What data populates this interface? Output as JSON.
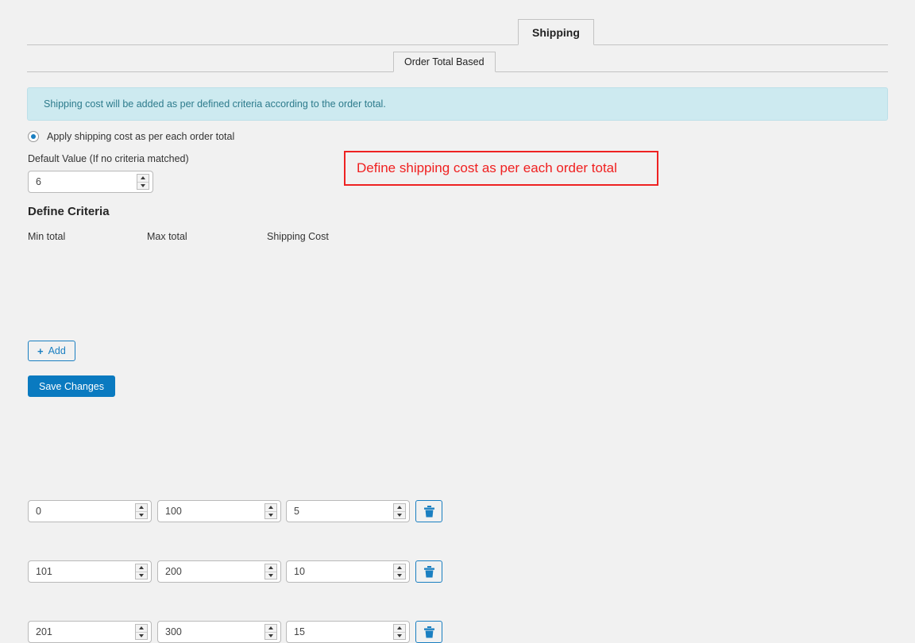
{
  "tabs": {
    "primary": [
      {
        "label": "Shipping",
        "active": true
      }
    ],
    "secondary": [
      {
        "label": "Order Total Based",
        "active": true
      }
    ]
  },
  "alert": {
    "icon": "info-icon",
    "text": "Shipping cost will be added as per defined criteria according to the order total.",
    "bg_color": "#cdeaf0",
    "text_color": "#2d7b8c"
  },
  "options": {
    "radio_label": "Apply shipping cost as per each order total",
    "radio_selected": true,
    "accent_color": "#1a7fc1"
  },
  "default_value": {
    "label": "Default Value (If no criteria matched)",
    "value": "6"
  },
  "annotation": {
    "text": "Define shipping cost as per each order total",
    "color": "#ee2222"
  },
  "criteria": {
    "title": "Define Criteria",
    "columns": [
      "Min total",
      "Max total",
      "Shipping Cost"
    ],
    "rows": [
      {
        "min": "0",
        "max": "100",
        "cost": "5",
        "delete_icon": "trash-icon"
      },
      {
        "min": "101",
        "max": "200",
        "cost": "10",
        "delete_icon": "trash-icon"
      },
      {
        "min": "201",
        "max": "300",
        "cost": "15",
        "delete_icon": "trash-icon"
      }
    ]
  },
  "buttons": {
    "add": {
      "label": "Add",
      "icon": "plus-icon"
    },
    "save": {
      "label": "Save Changes",
      "color": "#0a7ac0"
    }
  }
}
